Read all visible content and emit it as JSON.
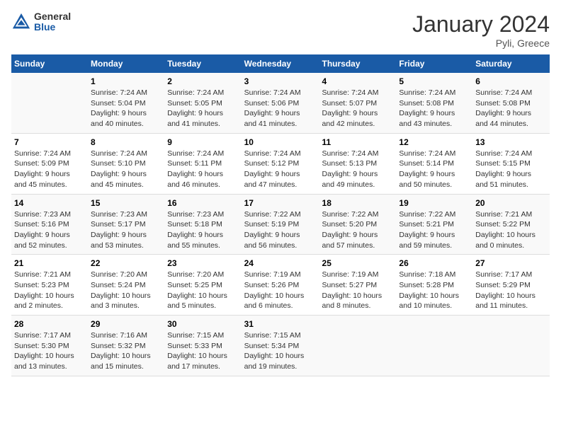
{
  "header": {
    "logo_general": "General",
    "logo_blue": "Blue",
    "month_title": "January 2024",
    "location": "Pyli, Greece"
  },
  "days_of_week": [
    "Sunday",
    "Monday",
    "Tuesday",
    "Wednesday",
    "Thursday",
    "Friday",
    "Saturday"
  ],
  "weeks": [
    [
      {
        "day": "",
        "info": []
      },
      {
        "day": "1",
        "info": [
          "Sunrise: 7:24 AM",
          "Sunset: 5:04 PM",
          "Daylight: 9 hours",
          "and 40 minutes."
        ]
      },
      {
        "day": "2",
        "info": [
          "Sunrise: 7:24 AM",
          "Sunset: 5:05 PM",
          "Daylight: 9 hours",
          "and 41 minutes."
        ]
      },
      {
        "day": "3",
        "info": [
          "Sunrise: 7:24 AM",
          "Sunset: 5:06 PM",
          "Daylight: 9 hours",
          "and 41 minutes."
        ]
      },
      {
        "day": "4",
        "info": [
          "Sunrise: 7:24 AM",
          "Sunset: 5:07 PM",
          "Daylight: 9 hours",
          "and 42 minutes."
        ]
      },
      {
        "day": "5",
        "info": [
          "Sunrise: 7:24 AM",
          "Sunset: 5:08 PM",
          "Daylight: 9 hours",
          "and 43 minutes."
        ]
      },
      {
        "day": "6",
        "info": [
          "Sunrise: 7:24 AM",
          "Sunset: 5:08 PM",
          "Daylight: 9 hours",
          "and 44 minutes."
        ]
      }
    ],
    [
      {
        "day": "7",
        "info": [
          "Sunrise: 7:24 AM",
          "Sunset: 5:09 PM",
          "Daylight: 9 hours",
          "and 45 minutes."
        ]
      },
      {
        "day": "8",
        "info": [
          "Sunrise: 7:24 AM",
          "Sunset: 5:10 PM",
          "Daylight: 9 hours",
          "and 45 minutes."
        ]
      },
      {
        "day": "9",
        "info": [
          "Sunrise: 7:24 AM",
          "Sunset: 5:11 PM",
          "Daylight: 9 hours",
          "and 46 minutes."
        ]
      },
      {
        "day": "10",
        "info": [
          "Sunrise: 7:24 AM",
          "Sunset: 5:12 PM",
          "Daylight: 9 hours",
          "and 47 minutes."
        ]
      },
      {
        "day": "11",
        "info": [
          "Sunrise: 7:24 AM",
          "Sunset: 5:13 PM",
          "Daylight: 9 hours",
          "and 49 minutes."
        ]
      },
      {
        "day": "12",
        "info": [
          "Sunrise: 7:24 AM",
          "Sunset: 5:14 PM",
          "Daylight: 9 hours",
          "and 50 minutes."
        ]
      },
      {
        "day": "13",
        "info": [
          "Sunrise: 7:24 AM",
          "Sunset: 5:15 PM",
          "Daylight: 9 hours",
          "and 51 minutes."
        ]
      }
    ],
    [
      {
        "day": "14",
        "info": [
          "Sunrise: 7:23 AM",
          "Sunset: 5:16 PM",
          "Daylight: 9 hours",
          "and 52 minutes."
        ]
      },
      {
        "day": "15",
        "info": [
          "Sunrise: 7:23 AM",
          "Sunset: 5:17 PM",
          "Daylight: 9 hours",
          "and 53 minutes."
        ]
      },
      {
        "day": "16",
        "info": [
          "Sunrise: 7:23 AM",
          "Sunset: 5:18 PM",
          "Daylight: 9 hours",
          "and 55 minutes."
        ]
      },
      {
        "day": "17",
        "info": [
          "Sunrise: 7:22 AM",
          "Sunset: 5:19 PM",
          "Daylight: 9 hours",
          "and 56 minutes."
        ]
      },
      {
        "day": "18",
        "info": [
          "Sunrise: 7:22 AM",
          "Sunset: 5:20 PM",
          "Daylight: 9 hours",
          "and 57 minutes."
        ]
      },
      {
        "day": "19",
        "info": [
          "Sunrise: 7:22 AM",
          "Sunset: 5:21 PM",
          "Daylight: 9 hours",
          "and 59 minutes."
        ]
      },
      {
        "day": "20",
        "info": [
          "Sunrise: 7:21 AM",
          "Sunset: 5:22 PM",
          "Daylight: 10 hours",
          "and 0 minutes."
        ]
      }
    ],
    [
      {
        "day": "21",
        "info": [
          "Sunrise: 7:21 AM",
          "Sunset: 5:23 PM",
          "Daylight: 10 hours",
          "and 2 minutes."
        ]
      },
      {
        "day": "22",
        "info": [
          "Sunrise: 7:20 AM",
          "Sunset: 5:24 PM",
          "Daylight: 10 hours",
          "and 3 minutes."
        ]
      },
      {
        "day": "23",
        "info": [
          "Sunrise: 7:20 AM",
          "Sunset: 5:25 PM",
          "Daylight: 10 hours",
          "and 5 minutes."
        ]
      },
      {
        "day": "24",
        "info": [
          "Sunrise: 7:19 AM",
          "Sunset: 5:26 PM",
          "Daylight: 10 hours",
          "and 6 minutes."
        ]
      },
      {
        "day": "25",
        "info": [
          "Sunrise: 7:19 AM",
          "Sunset: 5:27 PM",
          "Daylight: 10 hours",
          "and 8 minutes."
        ]
      },
      {
        "day": "26",
        "info": [
          "Sunrise: 7:18 AM",
          "Sunset: 5:28 PM",
          "Daylight: 10 hours",
          "and 10 minutes."
        ]
      },
      {
        "day": "27",
        "info": [
          "Sunrise: 7:17 AM",
          "Sunset: 5:29 PM",
          "Daylight: 10 hours",
          "and 11 minutes."
        ]
      }
    ],
    [
      {
        "day": "28",
        "info": [
          "Sunrise: 7:17 AM",
          "Sunset: 5:30 PM",
          "Daylight: 10 hours",
          "and 13 minutes."
        ]
      },
      {
        "day": "29",
        "info": [
          "Sunrise: 7:16 AM",
          "Sunset: 5:32 PM",
          "Daylight: 10 hours",
          "and 15 minutes."
        ]
      },
      {
        "day": "30",
        "info": [
          "Sunrise: 7:15 AM",
          "Sunset: 5:33 PM",
          "Daylight: 10 hours",
          "and 17 minutes."
        ]
      },
      {
        "day": "31",
        "info": [
          "Sunrise: 7:15 AM",
          "Sunset: 5:34 PM",
          "Daylight: 10 hours",
          "and 19 minutes."
        ]
      },
      {
        "day": "",
        "info": []
      },
      {
        "day": "",
        "info": []
      },
      {
        "day": "",
        "info": []
      }
    ]
  ]
}
